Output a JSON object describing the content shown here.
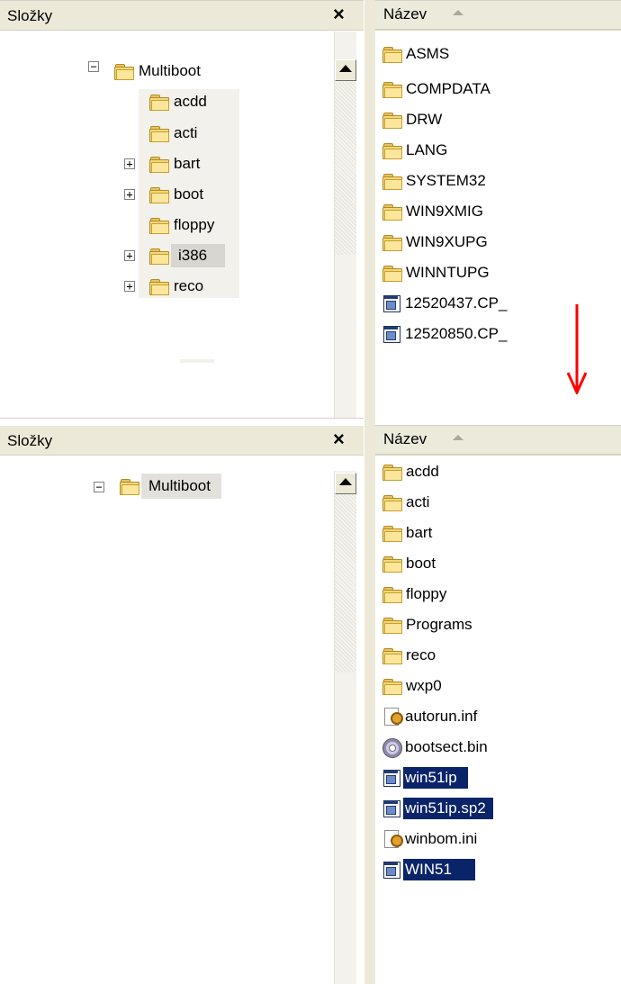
{
  "pane_title": "Složky",
  "close_glyph": "×",
  "column_header": "Název",
  "top": {
    "tree_root": "Multiboot",
    "tree_items": [
      "acdd",
      "acti",
      "bart",
      "boot",
      "floppy",
      "i386",
      "reco"
    ],
    "selected_tree_item": "i386",
    "files": [
      "ASMS",
      "COMPDATA",
      "DRW",
      "LANG",
      "SYSTEM32",
      "WIN9XMIG",
      "WIN9XUPG",
      "WINNTUPG",
      "12520437.CP_",
      "12520850.CP_"
    ]
  },
  "bottom": {
    "tree_root": "Multiboot",
    "files": [
      "acdd",
      "acti",
      "bart",
      "boot",
      "floppy",
      "Programs",
      "reco",
      "wxp0",
      "autorun.inf",
      "bootsect.bin",
      "win51ip",
      "win51ip.sp2",
      "winbom.ini",
      "WIN51"
    ],
    "selected_files": [
      "win51ip",
      "win51ip.sp2",
      "WIN51"
    ]
  },
  "colors": {
    "arrow": "#ff0000",
    "selection": "#0a246a"
  }
}
